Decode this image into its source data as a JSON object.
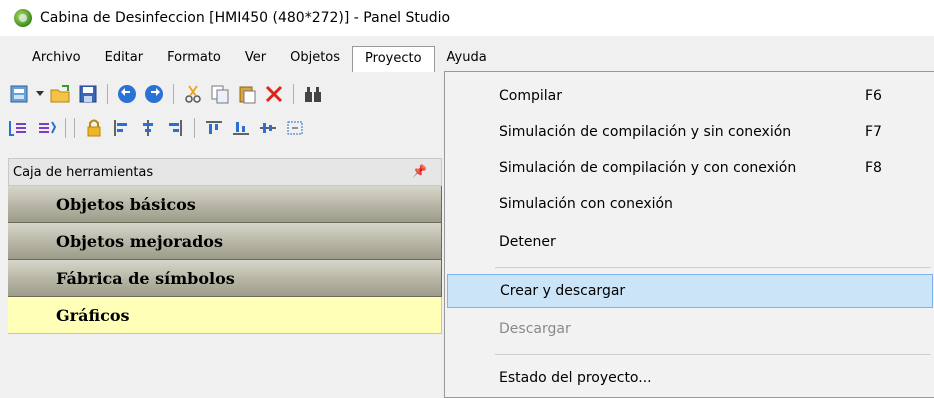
{
  "window": {
    "title": "Cabina de Desinfeccion [HMI450 (480*272)] - Panel Studio",
    "icon": "app-logo-icon"
  },
  "menubar": {
    "items": [
      "Archivo",
      "Editar",
      "Formato",
      "Ver",
      "Objetos",
      "Proyecto",
      "Ayuda"
    ],
    "active": "Proyecto"
  },
  "toolbar_row1": {
    "icons": [
      "new-file-icon",
      "dropdown-arrow-icon",
      "open-folder-icon",
      "save-icon",
      "undo-icon",
      "redo-icon",
      "cut-icon",
      "copy-icon",
      "paste-icon",
      "delete-icon",
      "find-icon"
    ]
  },
  "toolbar_row2": {
    "icons": [
      "group-icon",
      "ungroup-icon",
      "lock-icon",
      "align-left-icon",
      "align-center-icon",
      "align-right-icon",
      "align-top-icon",
      "align-bottom-icon",
      "align-middle-icon",
      "same-size-icon"
    ]
  },
  "toolbox": {
    "title": "Caja de herramientas",
    "pin_icon": "pin-icon",
    "categories": [
      "Objetos básicos",
      "Objetos mejorados",
      "Fábrica de símbolos",
      "Gráficos"
    ]
  },
  "project_menu": {
    "items": [
      {
        "label": "Compilar",
        "shortcut": "F6"
      },
      {
        "label": "Simulación de compilación y sin conexión",
        "shortcut": "F7"
      },
      {
        "label": "Simulación de compilación y con conexión",
        "shortcut": "F8"
      },
      {
        "label": "Simulación con conexión",
        "shortcut": ""
      },
      {
        "label": "Detener",
        "shortcut": ""
      },
      {
        "label": "Crear y descargar",
        "shortcut": "",
        "highlighted": true
      },
      {
        "label": "Descargar",
        "shortcut": "",
        "disabled": true
      },
      {
        "label": "Estado del proyecto...",
        "shortcut": ""
      }
    ]
  },
  "colors": {
    "highlight": "#cce4f7",
    "highlight_border": "#7eb4ea",
    "category_selected": "#ffffb8",
    "disabled_text": "#8a8a8a"
  }
}
